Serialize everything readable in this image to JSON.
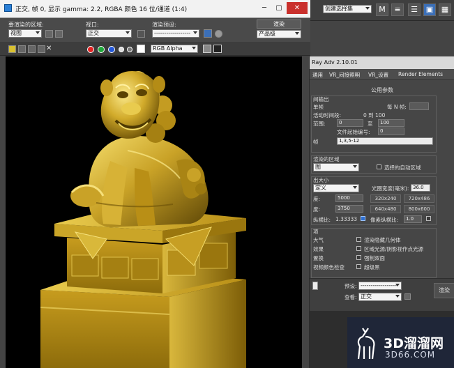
{
  "frame_window": {
    "title": "正交, 帧 0, 显示 gamma: 2.2, RGBA 颜色 16 位/通道 (1:4)",
    "area_label": "要渲染的区域:",
    "area_value": "视图",
    "viewport_label": "视口:",
    "viewport_value": "正交",
    "preset_label": "渲染预设:",
    "preset_value": "------------------",
    "render_button": "渲染",
    "product_value": "产品级",
    "channel_value": "RGB Alpha"
  },
  "main_toolbar": {
    "selection_set": "创建选择集"
  },
  "vray": {
    "title": "Ray Adv 2.10.01",
    "tabs": [
      "通用",
      "VR_间接照明",
      "VR_设置",
      "Render Elements"
    ],
    "section_title": "公用参数",
    "output_group": "间输出",
    "single": "单帧",
    "every_n": "每 N 帧:",
    "active_segment": "活动时间段:",
    "active_range": "0 到 100",
    "range_label": "范围:",
    "range_from": "0",
    "range_to_label": "至",
    "range_to": "100",
    "file_start": "文件起始编号:",
    "file_start_value": "0",
    "frames_label": "帧",
    "frames_value": "1,3,5-12",
    "region_group": "渲染的区域",
    "region_value": "图",
    "auto_region": "选择的自动区域",
    "size_group": "出大小",
    "size_value": "定义",
    "aperture_label": "光圈宽度(毫米):",
    "aperture_value": "36.0",
    "width_label": "度:",
    "width_value": "5000",
    "height_label": "度:",
    "height_value": "3750",
    "presets": [
      "320x240",
      "720x486",
      "640x480",
      "800x600"
    ],
    "aspect_label": "纵横比:",
    "aspect_value": "1.33333",
    "pixel_aspect_label": "像素纵横比:",
    "pixel_aspect_value": "1.0",
    "options_group": "项",
    "opt_atmosphere": "大气",
    "opt_hidden_geo": "渲染隐藏几何体",
    "opt_effects": "效果",
    "opt_area_lights": "区域光源/阴影视作点光源",
    "opt_displacement": "置换",
    "opt_force_2side": "强制双面",
    "opt_video_check": "视频颜色检查",
    "opt_super_black": "超级黑",
    "bottom_preset_label": "预设:",
    "bottom_preset_value": "------------------",
    "bottom_view_label": "查看:",
    "bottom_view_value": "正交",
    "bottom_render": "渲染"
  },
  "watermark": {
    "brand": "3D溜溜网",
    "url": "3D66.COM"
  },
  "colors": {
    "gold": "#c9a227",
    "gold_dark": "#6e5508",
    "gold_light": "#f1d96a"
  }
}
